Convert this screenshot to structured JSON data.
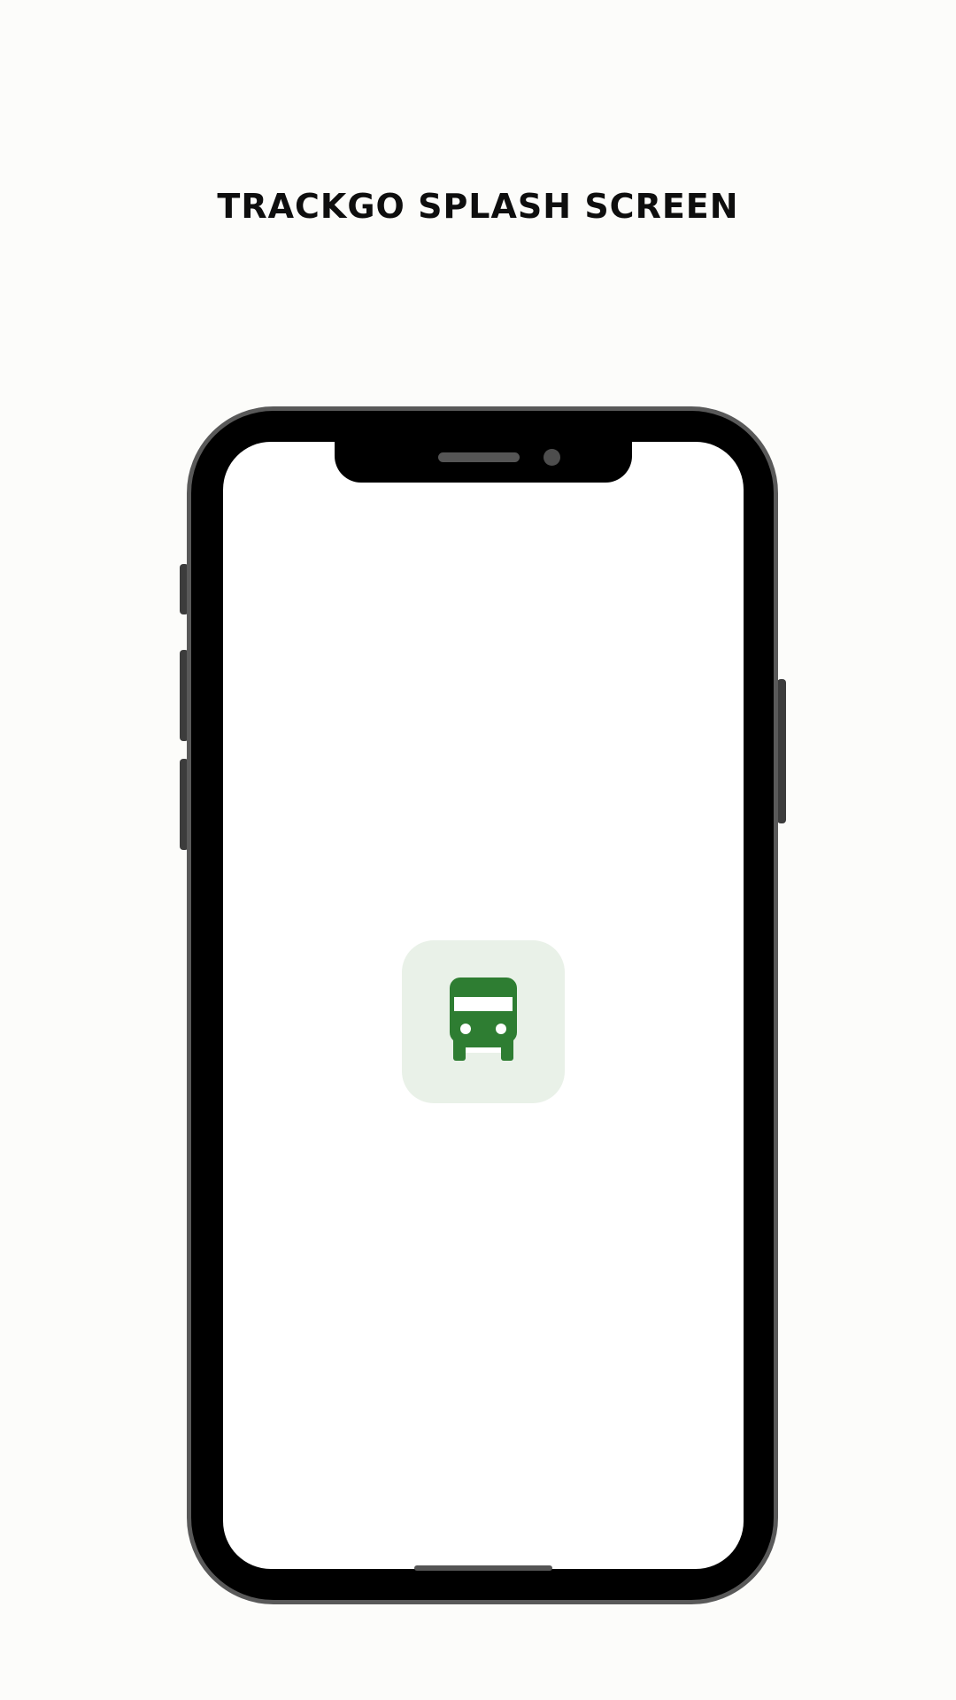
{
  "page": {
    "title": "TRACKGO SPLASH SCREEN"
  },
  "splash": {
    "logo_icon": "bus-icon",
    "logo_background_color": "#e9f1e8",
    "logo_icon_color": "#2e7d32"
  }
}
